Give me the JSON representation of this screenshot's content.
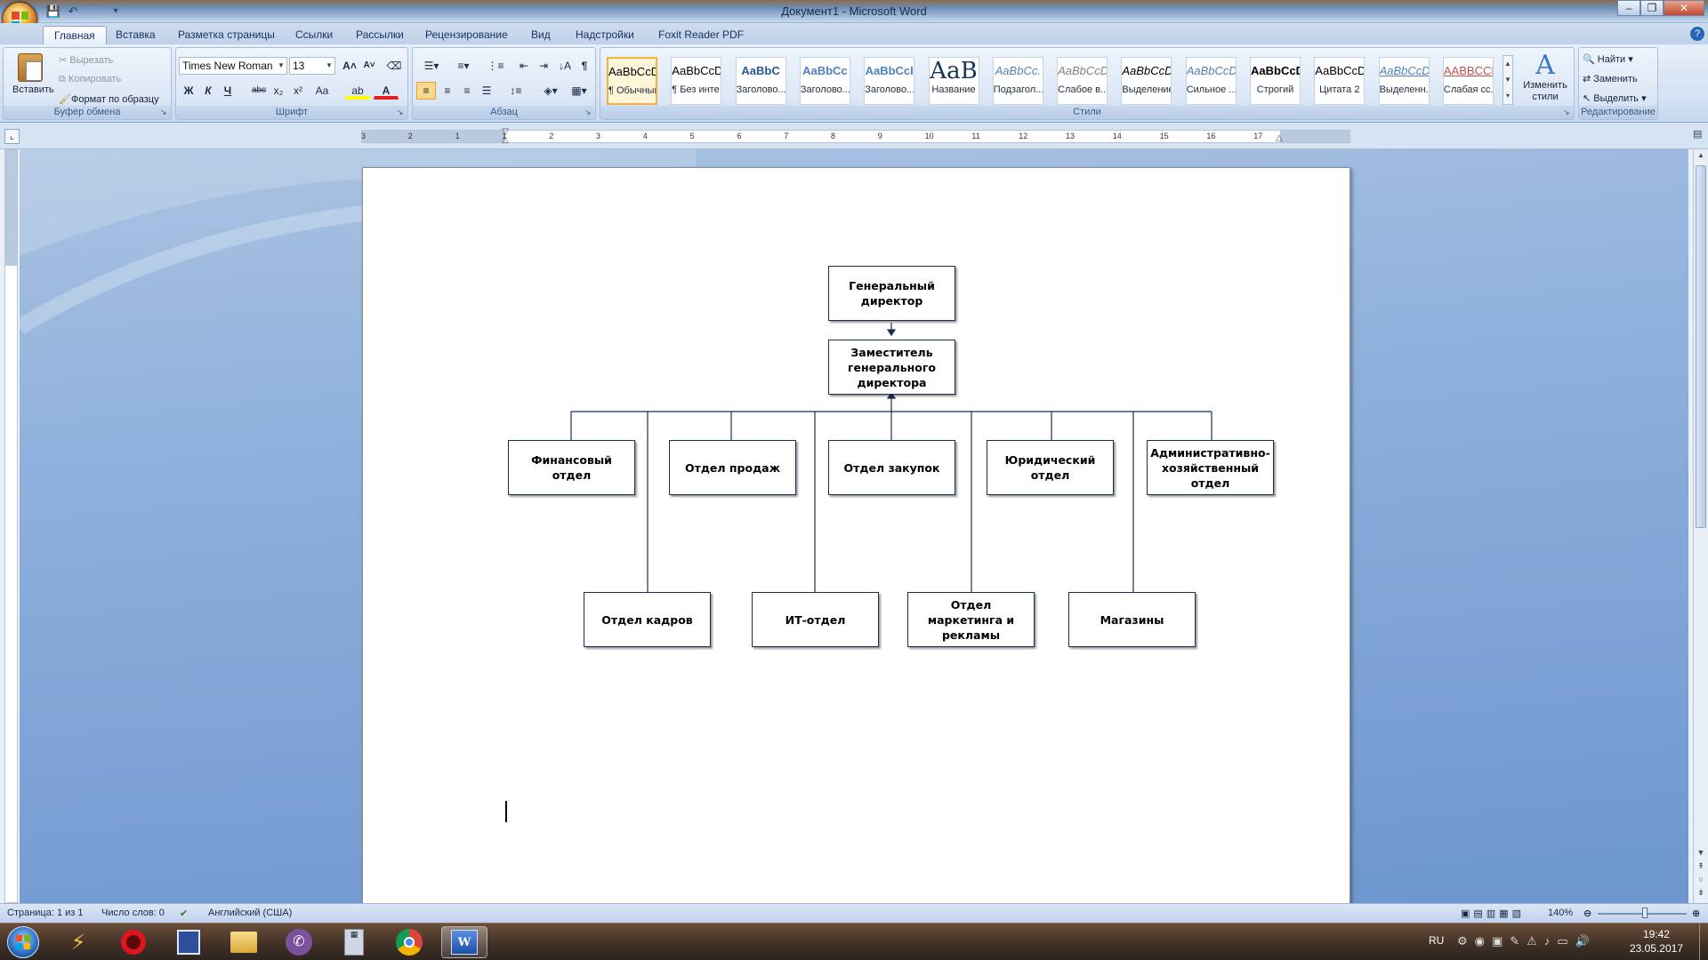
{
  "window": {
    "title": "Документ1 - Microsoft Word",
    "controls": {
      "minimize": "–",
      "restore": "❐",
      "close": "✕"
    }
  },
  "tabs": [
    "Главная",
    "Вставка",
    "Разметка страницы",
    "Ссылки",
    "Рассылки",
    "Рецензирование",
    "Вид",
    "Надстройки",
    "Foxit Reader PDF"
  ],
  "ribbon": {
    "clipboard": {
      "paste": "Вставить",
      "cut": "Вырезать",
      "copy": "Копировать",
      "format_painter": "Формат по образцу",
      "label": "Буфер обмена"
    },
    "font": {
      "name": "Times New Roman",
      "size": "13",
      "label": "Шрифт",
      "buttons": [
        "Ж",
        "К",
        "Ч",
        "abc",
        "x₂",
        "x²",
        "Aa"
      ]
    },
    "paragraph": {
      "label": "Абзац"
    },
    "styles": {
      "label": "Стили",
      "items": [
        {
          "sample": "AaBbCcDc",
          "name": "¶ Обычный",
          "color": "#000000"
        },
        {
          "sample": "AaBbCcDc",
          "name": "¶ Без инте...",
          "color": "#000000"
        },
        {
          "sample": "AaBbC",
          "name": "Заголово...",
          "color": "#2a5696"
        },
        {
          "sample": "AaBbCc",
          "name": "Заголово...",
          "color": "#4f81bd"
        },
        {
          "sample": "AaBbCcI",
          "name": "Заголово...",
          "color": "#4f81bd"
        },
        {
          "sample": "AaB",
          "name": "Название",
          "color": "#17365d"
        },
        {
          "sample": "AaBbCc.",
          "name": "Подзагол...",
          "color": "#4f81bd"
        },
        {
          "sample": "AaBbCcDi",
          "name": "Слабое в...",
          "color": "#808080"
        },
        {
          "sample": "AaBbCcDi",
          "name": "Выделение",
          "color": "#000000"
        },
        {
          "sample": "AaBbCcDi",
          "name": "Сильное ...",
          "color": "#4f81bd"
        },
        {
          "sample": "AaBbCcDc",
          "name": "Строгий",
          "color": "#000000"
        },
        {
          "sample": "AaBbCcDc",
          "name": "Цитата 2",
          "color": "#000000"
        },
        {
          "sample": "AaBbCcDi",
          "name": "Выделенн...",
          "color": "#4f81bd"
        },
        {
          "sample": "AABBCCDI",
          "name": "Слабая сс...",
          "color": "#c0504d"
        }
      ],
      "change_styles": "Изменить стили"
    },
    "editing": {
      "find": "Найти",
      "replace": "Заменить",
      "select": "Выделить",
      "label": "Редактирование"
    }
  },
  "ruler": {
    "labels": [
      "3",
      "2",
      "1",
      "1",
      "2",
      "3",
      "4",
      "5",
      "6",
      "7",
      "8",
      "9",
      "10",
      "11",
      "12",
      "13",
      "14",
      "15",
      "16",
      "17"
    ]
  },
  "orgchart": {
    "ceo": "Генеральный директор",
    "deputy": "Заместитель генерального директора",
    "row1": [
      "Финансовый отдел",
      "Отдел продаж",
      "Отдел закупок",
      "Юридический отдел",
      "Административно-хозяйственный отдел"
    ],
    "row2": [
      "Отдел кадров",
      "ИТ-отдел",
      "Отдел маркетинга и рекламы",
      "Магазины"
    ]
  },
  "status": {
    "page": "Страница: 1 из 1",
    "words": "Число слов: 0",
    "language": "Английский (США)",
    "zoom": "140%"
  },
  "taskbar": {
    "apps": [
      "start-orb",
      "app-launcher",
      "opera",
      "save-app",
      "file-explorer",
      "viber",
      "calculator",
      "chrome",
      "word"
    ],
    "lang": "RU",
    "time": "19:42",
    "date": "23.05.2017"
  }
}
